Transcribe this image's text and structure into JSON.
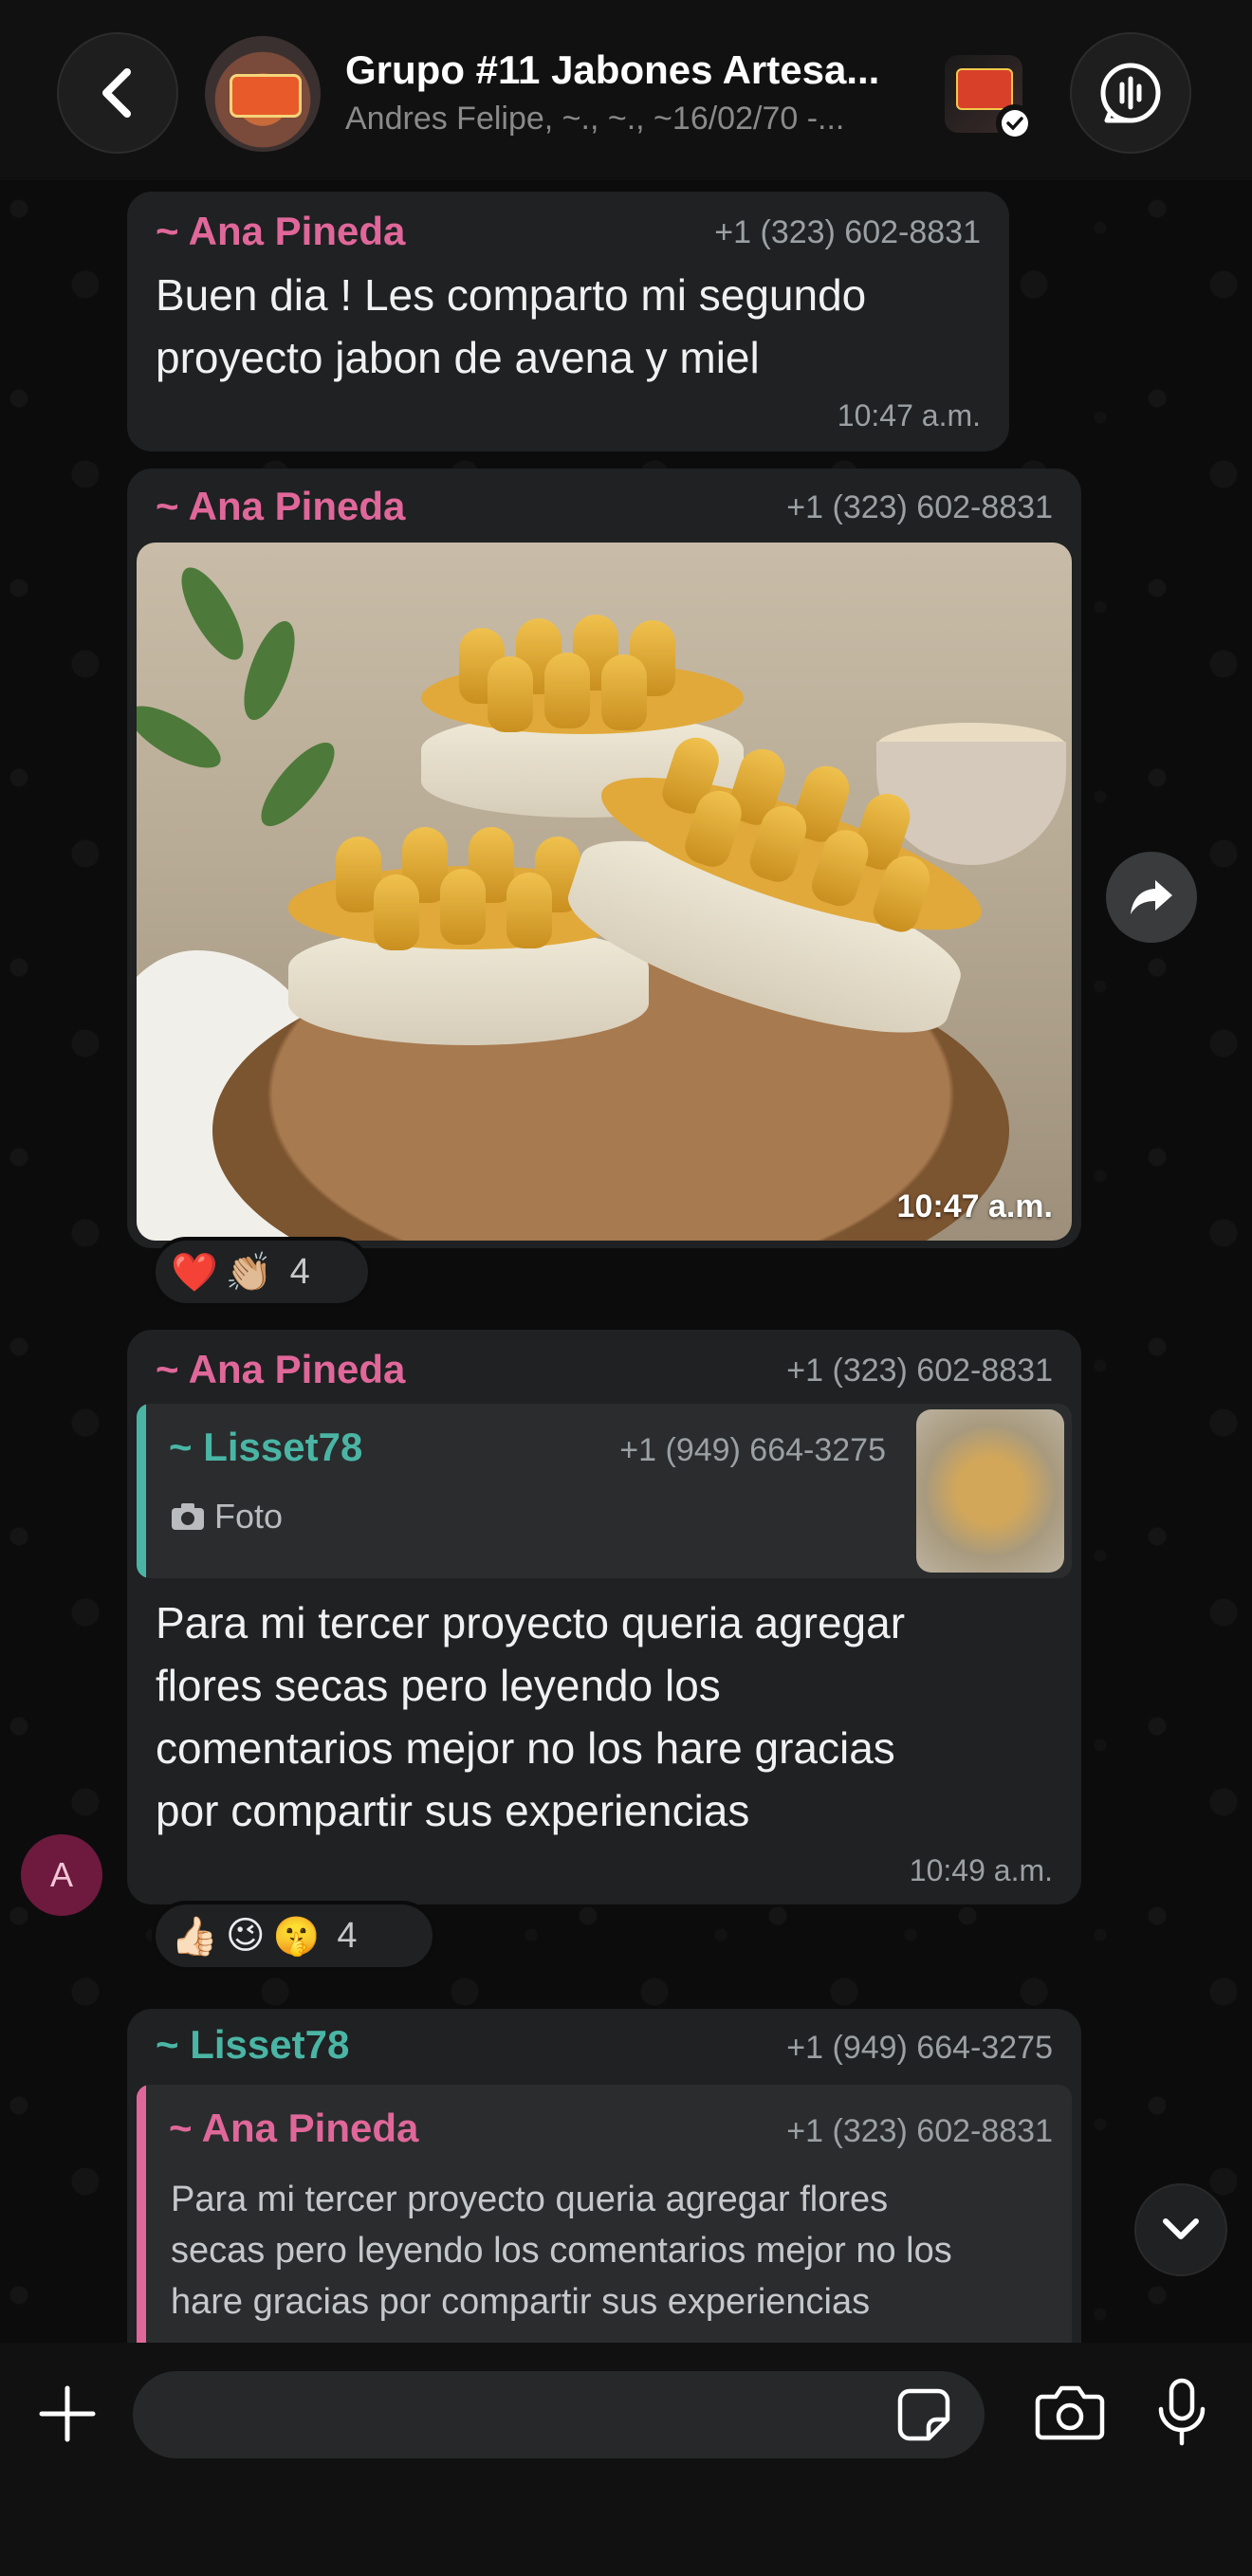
{
  "header": {
    "title": "Grupo #11 Jabones Artesa...",
    "subtitle": "Andres Felipe, ~., ~., ~16/02/70 -..."
  },
  "messages": [
    {
      "sender": "~ Ana Pineda",
      "phone": "+1 (323) 602-8831",
      "text_lines": [
        "Buen dia ! Les comparto mi segundo",
        "proyecto jabon de avena y miel"
      ],
      "time": "10:47 a.m."
    },
    {
      "sender": "~ Ana Pineda",
      "phone": "+1 (323) 602-8831",
      "time": "10:47 a.m.",
      "reactions": [
        "❤️",
        "👏🏼"
      ],
      "reaction_count": "4"
    },
    {
      "sender": "~ Ana Pineda",
      "phone": "+1 (323) 602-8831",
      "quoted": {
        "sender": "~ Lisset78",
        "phone": "+1 (949) 664-3275",
        "text": "Foto"
      },
      "text_lines": [
        "Para mi  tercer  proyecto queria agregar",
        "flores secas pero leyendo los",
        "comentarios  mejor no los hare gracias",
        "por compartir sus experiencias"
      ],
      "time": "10:49 a.m.",
      "reactions": [
        "👍🏻",
        "😉",
        "🤫"
      ],
      "reaction_count": "4",
      "avatar_initial": "A"
    },
    {
      "sender": "~ Lisset78",
      "phone": "+1 (949) 664-3275",
      "quoted": {
        "sender": "~ Ana Pineda",
        "phone": "+1 (323) 602-8831",
        "text_lines": [
          "Para mi  tercer  proyecto queria agregar flores",
          "secas pero leyendo los comentarios  mejor no los",
          "hare gracias por compartir sus experiencias"
        ]
      }
    }
  ],
  "composer": {
    "value": "",
    "placeholder": ""
  },
  "colors": {
    "pink_name": "#e0679a",
    "teal_name": "#4ab5a5",
    "bubble": "#1f2122"
  },
  "icons": [
    "back-chevron-icon",
    "audio-wave-icon",
    "forward-icon",
    "camera-icon",
    "chevron-down-icon",
    "plus-icon",
    "sticker-icon",
    "mic-icon",
    "check-icon"
  ]
}
